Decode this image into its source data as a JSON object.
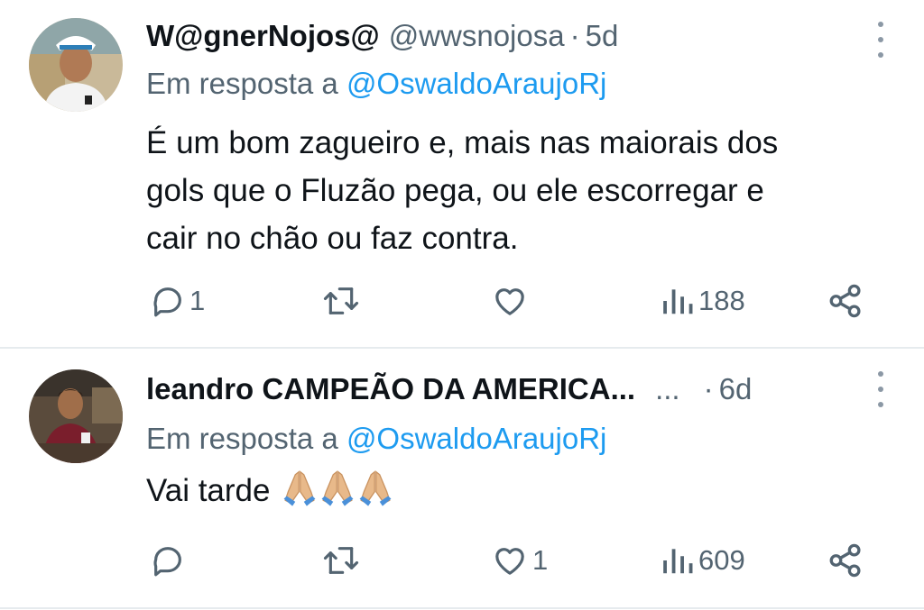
{
  "tweets": [
    {
      "name": "W@gnerNojos@",
      "handle": "@wwsnojosa",
      "separator": "·",
      "time": "5d",
      "reply_prefix": "Em resposta a",
      "reply_mention": "@OswaldoAraujoRj",
      "text_lines": [
        "É  um bom zagueiro e, mais nas maiorais dos",
        "gols que o Fluzão pega, ou ele escorregar e",
        "cair no chão ou faz contra."
      ],
      "stats": {
        "replies": "1",
        "retweets": "",
        "likes": "",
        "views": "188"
      }
    },
    {
      "name": "leandro CAMPEÃO DA AMERICA...",
      "handle": "...",
      "separator": "·",
      "time": "6d",
      "reply_prefix": "Em resposta a",
      "reply_mention": "@OswaldoAraujoRj",
      "text": "Vai tarde",
      "emoji": [
        "folded-hands",
        "folded-hands",
        "folded-hands"
      ],
      "stats": {
        "replies": "",
        "retweets": "",
        "likes": "1",
        "views": "609"
      }
    }
  ],
  "icons": {
    "reply": "speech-bubble-icon",
    "retweet": "retweet-icon",
    "like": "heart-icon",
    "views": "bar-chart-icon",
    "share": "share-icon",
    "more": "vertical-dots-icon"
  },
  "colors": {
    "text": "#0f1419",
    "secondary": "#536471",
    "link": "#1d9bf0",
    "divider": "#e6ebee"
  }
}
